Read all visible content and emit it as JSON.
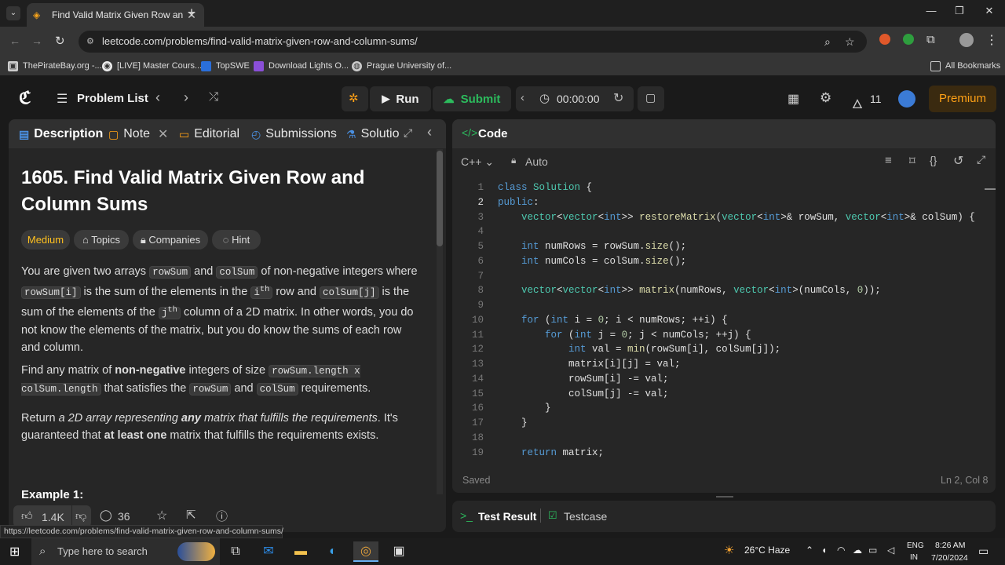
{
  "browser": {
    "tab_title": "Find Valid Matrix Given Row an",
    "url": "leetcode.com/problems/find-valid-matrix-given-row-and-column-sums/",
    "bookmarks": [
      "ThePirateBay.org -...",
      "[LIVE] Master Cours...",
      "TopSWE",
      "Download Lights O...",
      "Prague University of..."
    ],
    "all_bookmarks": "All Bookmarks",
    "status_url": "https://leetcode.com/problems/find-valid-matrix-given-row-and-column-sums/"
  },
  "nav": {
    "problem_list": "Problem List",
    "run": "Run",
    "submit": "Submit",
    "timer": "00:00:00",
    "streak": "11",
    "premium": "Premium"
  },
  "left_tabs": {
    "description": "Description",
    "note": "Note",
    "editorial": "Editorial",
    "submissions": "Submissions",
    "solutions": "Solutio"
  },
  "problem": {
    "title": "1605. Find Valid Matrix Given Row and Column Sums",
    "difficulty": "Medium",
    "topics": "Topics",
    "companies": "Companies",
    "hint": "Hint",
    "example_heading": "Example 1:",
    "likes": "1.4K",
    "comments": "36"
  },
  "code_panel": {
    "title": "Code",
    "language": "C++",
    "mode": "Auto",
    "saved": "Saved",
    "cursor": "Ln 2, Col 8",
    "line_numbers": [
      "1",
      "2",
      "3",
      "4",
      "5",
      "6",
      "7",
      "8",
      "9",
      "10",
      "11",
      "12",
      "13",
      "14",
      "15",
      "16",
      "17",
      "18",
      "19"
    ]
  },
  "test_panel": {
    "test_result": "Test Result",
    "testcase": "Testcase"
  },
  "taskbar": {
    "search_placeholder": "Type here to search",
    "weather": "26°C  Haze",
    "lang1": "ENG",
    "lang2": "IN",
    "time": "8:26 AM",
    "date": "7/20/2024"
  },
  "colors": {
    "accent_orange": "#ffa116",
    "submit_green": "#2cbb5d",
    "medium_yellow": "#ffc01e",
    "link_blue": "#4a90e2"
  }
}
